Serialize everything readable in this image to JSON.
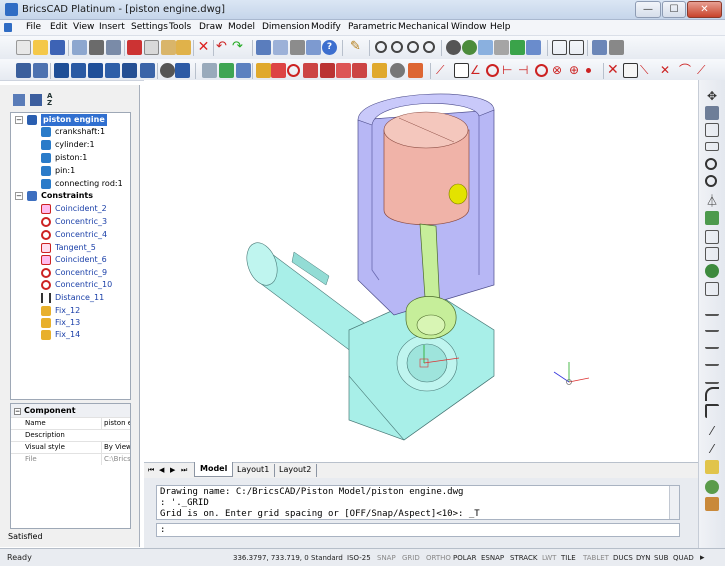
{
  "window": {
    "title": "BricsCAD Platinum - [piston engine.dwg]",
    "minimize": "—",
    "maximize": "☐",
    "close": "✕"
  },
  "menu": [
    "File",
    "Edit",
    "View",
    "Insert",
    "Settings",
    "Tools",
    "Draw",
    "Model",
    "Dimension",
    "Modify",
    "Parametric",
    "Mechanical",
    "Window",
    "Help"
  ],
  "tree": {
    "root": "piston engine",
    "components": [
      "crankshaft:1",
      "cylinder:1",
      "piston:1",
      "pin:1",
      "connecting rod:1"
    ],
    "constraints_label": "Constraints",
    "constraints": [
      "Coincident_2",
      "Concentric_3",
      "Concentric_4",
      "Tangent_5",
      "Coincident_6",
      "Concentric_9",
      "Concentric_10",
      "Distance_11",
      "Fix_12",
      "Fix_13",
      "Fix_14"
    ]
  },
  "properties": {
    "header": "Component",
    "rows": [
      {
        "key": "Name",
        "value": "piston en"
      },
      {
        "key": "Description",
        "value": ""
      },
      {
        "key": "Visual style",
        "value": "By Viewp"
      },
      {
        "key": "File",
        "value": "C:\\Brics("
      }
    ]
  },
  "panel_status": "Satisfied",
  "layout_tabs": [
    "Model",
    "Layout1",
    "Layout2"
  ],
  "command": {
    "lines": [
      "Drawing name: C:/BricsCAD/Piston Model/piston engine.dwg",
      ": '._GRID",
      "Grid is on. Enter grid spacing or [OFF/Snap/Aspect]<10>: _T"
    ],
    "prompt": ":"
  },
  "status": {
    "ready": "Ready",
    "coords": "336.3797, 733.719, 0",
    "style": "Standard",
    "dimstyle": "ISO-25",
    "toggles": [
      "SNAP",
      "GRID",
      "ORTHO",
      "POLAR",
      "ESNAP",
      "STRACK",
      "LWT",
      "TILE",
      "TABLET",
      "DUCS",
      "DYN",
      "SUB",
      "QUAD"
    ]
  },
  "colors": {
    "accent": "#2f6cc4",
    "cylinder": "#b7b7f5",
    "piston": "#f0b3a8",
    "crank": "#a8efe8",
    "rod": "#c6ee9a"
  }
}
